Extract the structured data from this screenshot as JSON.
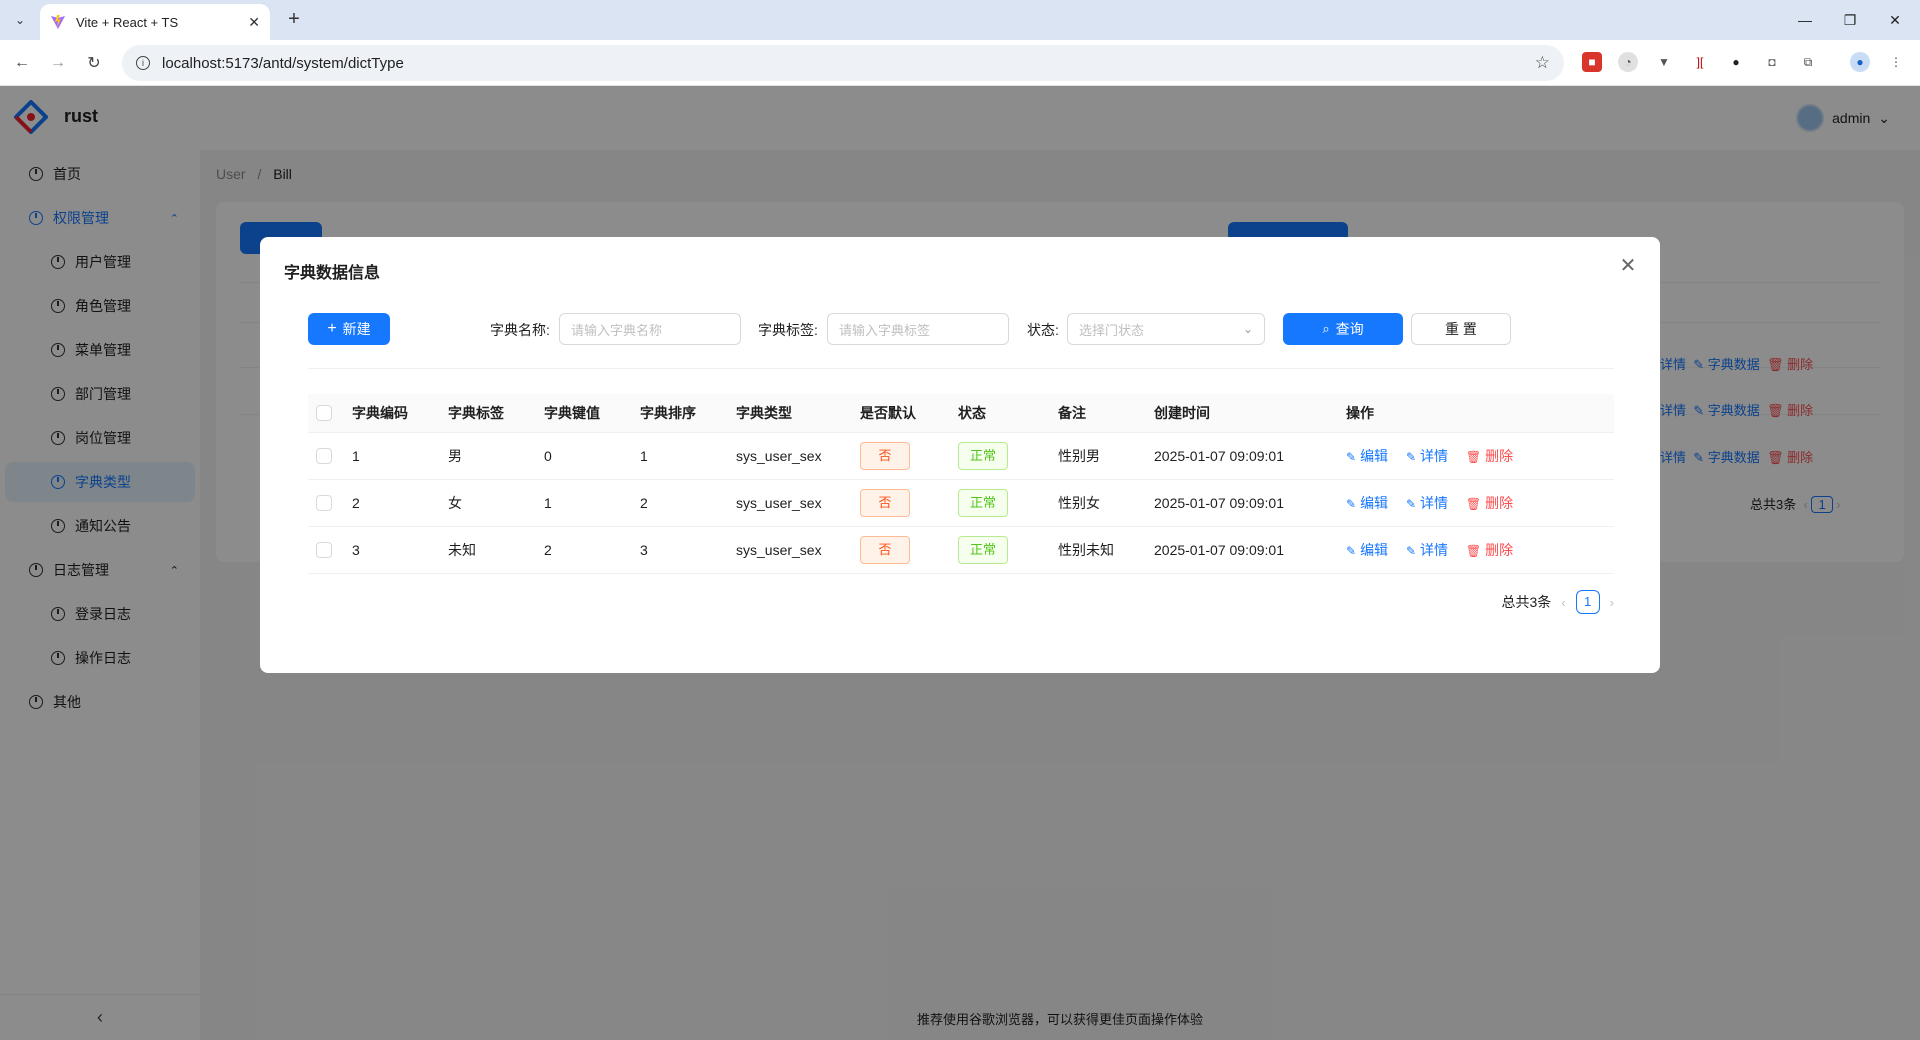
{
  "browser": {
    "tab_title": "Vite + React + TS",
    "url": "localhost:5173/antd/system/dictType"
  },
  "app": {
    "name": "rust",
    "user": "admin",
    "breadcrumb": [
      "User",
      "Bill"
    ],
    "footer": "推荐使用谷歌浏览器，可以获得更佳页面操作体验",
    "sidebar": {
      "home": "首页",
      "auth_group": "权限管理",
      "auth_items": [
        "用户管理",
        "角色管理",
        "菜单管理",
        "部门管理",
        "岗位管理",
        "字典类型",
        "通知公告"
      ],
      "log_group": "日志管理",
      "log_items": [
        "登录日志",
        "操作日志"
      ],
      "other": "其他"
    },
    "background_actions": [
      "详情",
      "字典数据",
      "删除"
    ],
    "background_total": "总共3条",
    "background_page": "1"
  },
  "modal": {
    "title": "字典数据信息",
    "new_label": "新建",
    "search": {
      "name_label": "字典名称:",
      "name_placeholder": "请输入字典名称",
      "tag_label": "字典标签:",
      "tag_placeholder": "请输入字典标签",
      "status_label": "状态:",
      "status_placeholder": "选择门状态",
      "query_label": "查询",
      "reset_label": "重 置"
    },
    "table": {
      "columns": [
        "字典编码",
        "字典标签",
        "字典键值",
        "字典排序",
        "字典类型",
        "是否默认",
        "状态",
        "备注",
        "创建时间",
        "操作"
      ],
      "rows": [
        {
          "code": "1",
          "label": "男",
          "value": "0",
          "sort": "1",
          "type": "sys_user_sex",
          "default": "否",
          "status": "正常",
          "remark": "性别男",
          "created": "2025-01-07 09:09:01"
        },
        {
          "code": "2",
          "label": "女",
          "value": "1",
          "sort": "2",
          "type": "sys_user_sex",
          "default": "否",
          "status": "正常",
          "remark": "性别女",
          "created": "2025-01-07 09:09:01"
        },
        {
          "code": "3",
          "label": "未知",
          "value": "2",
          "sort": "3",
          "type": "sys_user_sex",
          "default": "否",
          "status": "正常",
          "remark": "性别未知",
          "created": "2025-01-07 09:09:01"
        }
      ],
      "actions": {
        "edit": "编辑",
        "detail": "详情",
        "delete": "删除"
      }
    },
    "pagination": {
      "total": "总共3条",
      "page": "1"
    }
  },
  "colors": {
    "primary": "#1677ff",
    "danger": "#ff4d4f",
    "warning_tag": "#fa541c",
    "success_tag": "#52c41a"
  }
}
